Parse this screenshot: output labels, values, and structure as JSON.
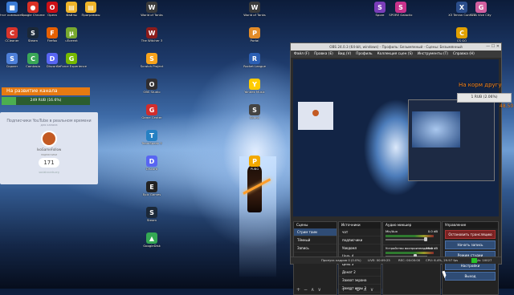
{
  "desktop_icons": [
    {
      "label": "Этот компьютер",
      "glyph": "■",
      "color": "#3a7bd5"
    },
    {
      "label": "Google Chrome",
      "glyph": "●",
      "color": "#d93025"
    },
    {
      "label": "Opera",
      "glyph": "O",
      "color": "#cc0f16"
    },
    {
      "label": "Файлы",
      "glyph": "▤",
      "color": "#f0b429"
    },
    {
      "label": "Программы",
      "glyph": "▤",
      "color": "#f0b429"
    },
    {
      "label": "CCleaner",
      "glyph": "C",
      "color": "#d9342b"
    },
    {
      "label": "Steam",
      "glyph": "S",
      "color": "#1b2838"
    },
    {
      "label": "Firefox",
      "glyph": "F",
      "color": "#e66000"
    },
    {
      "label": "uTorrent",
      "glyph": "µ",
      "color": "#78a92f"
    },
    {
      "label": "Скрипт",
      "glyph": "S",
      "color": "#4d7fd9"
    },
    {
      "label": "Camtasia",
      "glyph": "C",
      "color": "#3aa757"
    },
    {
      "label": "Discord",
      "glyph": "D",
      "color": "#5865f2"
    },
    {
      "label": "GeForce Experience",
      "glyph": "G",
      "color": "#76b900"
    },
    {
      "label": "World of Tanks",
      "glyph": "W",
      "color": "#3b3b3b"
    },
    {
      "label": "The Witcher 3",
      "glyph": "W",
      "color": "#8b1c1c"
    },
    {
      "label": "Scratch Project",
      "glyph": "S",
      "color": "#f7a31c"
    },
    {
      "label": "OBS Studio",
      "glyph": "O",
      "color": "#302e31"
    },
    {
      "label": "Game Center",
      "glyph": "G",
      "color": "#d12d2d"
    },
    {
      "label": "TeamSpeak 3",
      "glyph": "T",
      "color": "#2580c3"
    },
    {
      "label": "Discord",
      "glyph": "D",
      "color": "#5865f2"
    },
    {
      "label": "Epic Games",
      "glyph": "E",
      "color": "#222222"
    },
    {
      "label": "Steam",
      "glyph": "S",
      "color": "#1b2838"
    },
    {
      "label": "GoogleDisk",
      "glyph": "▲",
      "color": "#34a853"
    },
    {
      "label": "World of Tanks",
      "glyph": "W",
      "color": "#3b3b3b"
    },
    {
      "label": "Portal",
      "glyph": "P",
      "color": "#e28b28"
    },
    {
      "label": "Rocket League",
      "glyph": "R",
      "color": "#2b5fb4"
    },
    {
      "label": "Yandex Music",
      "glyph": "Y",
      "color": "#ffcc00"
    },
    {
      "label": "Sound",
      "glyph": "S",
      "color": "#444444"
    },
    {
      "label": "PUBG",
      "glyph": "P",
      "color": "#f2a900"
    },
    {
      "label": "Spore",
      "glyph": "S",
      "color": "#7a3db8"
    },
    {
      "label": "SPORE Galactic",
      "glyph": "S",
      "color": "#c8328c"
    },
    {
      "label": "X3 Terran Conflict",
      "glyph": "X",
      "color": "#2b4e8c"
    },
    {
      "label": "GTA Vice City",
      "glyph": "G",
      "color": "#d25f9f"
    },
    {
      "label": "CS GO",
      "glyph": "C",
      "color": "#e2a100"
    }
  ],
  "donation_panel": {
    "title": "На развитие канала",
    "progress_text": "249 RUB (16.6%)",
    "progress_fraction": 0.166
  },
  "youtube_widget": {
    "title": "Подписчики YouTube в реальном времени",
    "subtitle": "для канала",
    "channel": "IvoGameFollow",
    "subs_label": "подписчики",
    "count": "171",
    "link": "socialcounts.org"
  },
  "obs": {
    "window_title": "OBS 24.0.3 (64-bit, windows) - Профиль: Безымянный - Сцены: Безымянный",
    "menu": [
      "Файл (F)",
      "Правка (E)",
      "Вид (V)",
      "Профиль",
      "Коллекция сцен (S)",
      "Инструменты (T)",
      "Справка (H)"
    ],
    "scenes_header": "Сцены",
    "scenes": [
      "Стрим таим",
      "Тёмный",
      "Запись"
    ],
    "sources_header": "Источники",
    "sources": [
      "чат",
      "подписчики",
      "Уведомл",
      "Цель 4",
      "Цель 3",
      "Донат 2",
      "Захват экрана",
      "Захват игры 3"
    ],
    "mixer_header": "Аудио микшер",
    "mixer": [
      {
        "name": "Mic/Aux",
        "db": "0.0 dB",
        "level": 0.95
      },
      {
        "name": "Устройство воспроизведения",
        "db": "-15.0 dB",
        "level": 0.7
      }
    ],
    "controls_header": "Управление",
    "controls": [
      "Остановить трансляцию",
      "Начать запись",
      "Режим студии",
      "Настройки",
      "Выход"
    ],
    "status": {
      "dropped": "Пропуск кадров 0 (0.0%)",
      "live": "LIVE: 00:09:25",
      "rec": "REC: 00:00:00",
      "cpu": "CPU: 6.4%, 29.97 fps",
      "kbps": "kb/s: 10027"
    }
  },
  "stream_overlay": {
    "goal_title": "На корм другу",
    "goal_text": "1 RUB (2.06%)",
    "goal_fraction": 0.0206,
    "goal_target": "48.50"
  }
}
